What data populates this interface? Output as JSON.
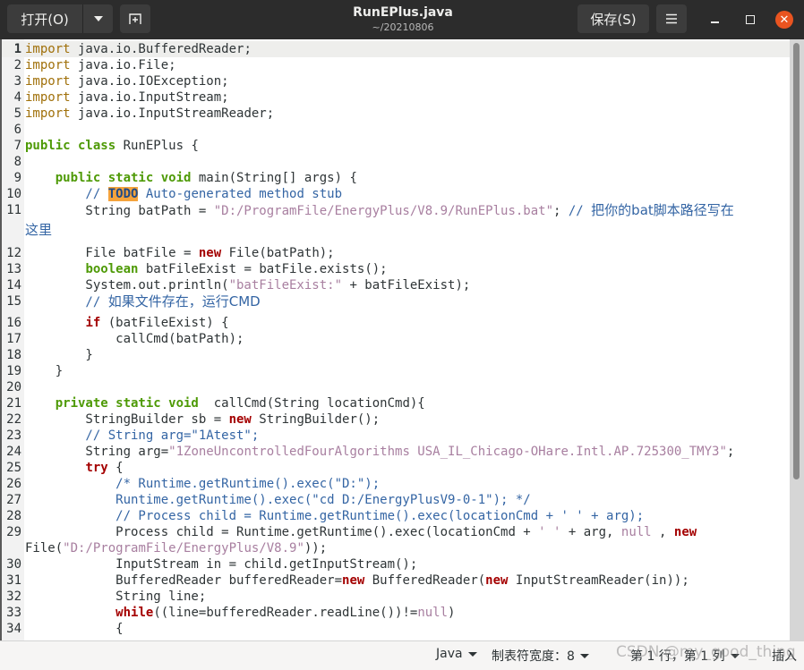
{
  "titlebar": {
    "open_label": "打开(O)",
    "title": "RunEPlus.java",
    "subtitle": "~/20210806",
    "save_label": "保存(S)",
    "close_glyph": "✕",
    "accent_close": "#e95420"
  },
  "editor": {
    "current_line": 1,
    "lines": [
      {
        "n": "1",
        "segments": [
          {
            "c": "kw-imp",
            "t": "import"
          },
          {
            "c": "",
            "t": " java.io.BufferedReader;"
          }
        ]
      },
      {
        "n": "2",
        "segments": [
          {
            "c": "kw-imp",
            "t": "import"
          },
          {
            "c": "",
            "t": " java.io.File;"
          }
        ]
      },
      {
        "n": "3",
        "segments": [
          {
            "c": "kw-imp",
            "t": "import"
          },
          {
            "c": "",
            "t": " java.io.IOException;"
          }
        ]
      },
      {
        "n": "4",
        "segments": [
          {
            "c": "kw-imp",
            "t": "import"
          },
          {
            "c": "",
            "t": " java.io.InputStream;"
          }
        ]
      },
      {
        "n": "5",
        "segments": [
          {
            "c": "kw-imp",
            "t": "import"
          },
          {
            "c": "",
            "t": " java.io.InputStreamReader;"
          }
        ]
      },
      {
        "n": "6",
        "segments": []
      },
      {
        "n": "7",
        "segments": [
          {
            "c": "kw-g",
            "t": "public class"
          },
          {
            "c": "",
            "t": " RunEPlus {"
          }
        ]
      },
      {
        "n": "8",
        "segments": []
      },
      {
        "n": "9",
        "segments": [
          {
            "c": "",
            "t": "    "
          },
          {
            "c": "kw-g",
            "t": "public static void"
          },
          {
            "c": "",
            "t": " main(String[] args) {"
          }
        ]
      },
      {
        "n": "10",
        "segments": [
          {
            "c": "cmt",
            "t": "        // "
          },
          {
            "c": "todo",
            "t": "TODO"
          },
          {
            "c": "cmt",
            "t": " Auto-generated method stub"
          }
        ]
      },
      {
        "n": "11",
        "segments": [
          {
            "c": "",
            "t": "        String batPath = "
          },
          {
            "c": "str",
            "t": "\"D:/ProgramFile/EnergyPlus/V8.9/RunEPlus.bat\""
          },
          {
            "c": "",
            "t": "; "
          },
          {
            "c": "cmt",
            "t": "// "
          },
          {
            "c": "cmt cjk",
            "t": "把你的bat脚本路径写在"
          }
        ],
        "wrap": [
          {
            "c": "cmt cjk",
            "t": "这里"
          }
        ]
      },
      {
        "n": "12",
        "segments": [
          {
            "c": "",
            "t": "        File batFile = "
          },
          {
            "c": "kw-r",
            "t": "new"
          },
          {
            "c": "",
            "t": " File(batPath);"
          }
        ]
      },
      {
        "n": "13",
        "segments": [
          {
            "c": "",
            "t": "        "
          },
          {
            "c": "kw-g",
            "t": "boolean"
          },
          {
            "c": "",
            "t": " batFileExist = batFile.exists();"
          }
        ]
      },
      {
        "n": "14",
        "segments": [
          {
            "c": "",
            "t": "        System.out.println("
          },
          {
            "c": "str",
            "t": "\"batFileExist:\""
          },
          {
            "c": "",
            "t": " + batFileExist);"
          }
        ]
      },
      {
        "n": "15",
        "segments": [
          {
            "c": "cmt",
            "t": "        // "
          },
          {
            "c": "cmt cjk",
            "t": "如果文件存在，运行CMD"
          }
        ]
      },
      {
        "n": "16",
        "segments": [
          {
            "c": "",
            "t": "        "
          },
          {
            "c": "kw-r",
            "t": "if"
          },
          {
            "c": "",
            "t": " (batFileExist) {"
          }
        ]
      },
      {
        "n": "17",
        "segments": [
          {
            "c": "",
            "t": "            callCmd(batPath);"
          }
        ]
      },
      {
        "n": "18",
        "segments": [
          {
            "c": "",
            "t": "        }"
          }
        ]
      },
      {
        "n": "19",
        "segments": [
          {
            "c": "",
            "t": "    }"
          }
        ]
      },
      {
        "n": "20",
        "segments": []
      },
      {
        "n": "21",
        "segments": [
          {
            "c": "",
            "t": "    "
          },
          {
            "c": "kw-g",
            "t": "private static void"
          },
          {
            "c": "",
            "t": "  callCmd(String locationCmd){"
          }
        ]
      },
      {
        "n": "22",
        "segments": [
          {
            "c": "",
            "t": "        StringBuilder sb = "
          },
          {
            "c": "kw-r",
            "t": "new"
          },
          {
            "c": "",
            "t": " StringBuilder();"
          }
        ]
      },
      {
        "n": "23",
        "segments": [
          {
            "c": "cmt",
            "t": "        // String arg=\"1Atest\";"
          }
        ]
      },
      {
        "n": "24",
        "segments": [
          {
            "c": "",
            "t": "        String arg="
          },
          {
            "c": "str",
            "t": "\"1ZoneUncontrolledFourAlgorithms USA_IL_Chicago-OHare.Intl.AP.725300_TMY3\""
          },
          {
            "c": "",
            "t": ";"
          }
        ]
      },
      {
        "n": "25",
        "segments": [
          {
            "c": "",
            "t": "        "
          },
          {
            "c": "kw-r",
            "t": "try"
          },
          {
            "c": "",
            "t": " {"
          }
        ]
      },
      {
        "n": "26",
        "segments": [
          {
            "c": "cmt",
            "t": "            /* Runtime.getRuntime().exec(\"D:\");"
          }
        ]
      },
      {
        "n": "27",
        "segments": [
          {
            "c": "cmt",
            "t": "            Runtime.getRuntime().exec(\"cd D:/EnergyPlusV9-0-1\"); */"
          }
        ]
      },
      {
        "n": "28",
        "segments": [
          {
            "c": "cmt",
            "t": "            // Process child = Runtime.getRuntime().exec(locationCmd + ' ' + arg);"
          }
        ]
      },
      {
        "n": "29",
        "segments": [
          {
            "c": "",
            "t": "            Process child = Runtime.getRuntime().exec(locationCmd + "
          },
          {
            "c": "str",
            "t": "' '"
          },
          {
            "c": "",
            "t": " + arg, "
          },
          {
            "c": "str",
            "t": "null"
          },
          {
            "c": "",
            "t": " , "
          },
          {
            "c": "kw-r",
            "t": "new"
          }
        ],
        "wrap": [
          {
            "c": "",
            "t": "File("
          },
          {
            "c": "str",
            "t": "\"D:/ProgramFile/EnergyPlus/V8.9\""
          },
          {
            "c": "",
            "t": "));"
          }
        ]
      },
      {
        "n": "30",
        "segments": [
          {
            "c": "",
            "t": "            InputStream in = child.getInputStream();"
          }
        ]
      },
      {
        "n": "31",
        "segments": [
          {
            "c": "",
            "t": "            BufferedReader bufferedReader="
          },
          {
            "c": "kw-r",
            "t": "new"
          },
          {
            "c": "",
            "t": " BufferedReader("
          },
          {
            "c": "kw-r",
            "t": "new"
          },
          {
            "c": "",
            "t": " InputStreamReader(in));"
          }
        ]
      },
      {
        "n": "32",
        "segments": [
          {
            "c": "",
            "t": "            String line;"
          }
        ]
      },
      {
        "n": "33",
        "segments": [
          {
            "c": "",
            "t": "            "
          },
          {
            "c": "kw-r",
            "t": "while"
          },
          {
            "c": "",
            "t": "((line=bufferedReader.readLine())!="
          },
          {
            "c": "str",
            "t": "null"
          },
          {
            "c": "",
            "t": ")"
          }
        ]
      },
      {
        "n": "34",
        "segments": [
          {
            "c": "",
            "t": "            {"
          }
        ]
      }
    ]
  },
  "statusbar": {
    "language": "Java",
    "tab_width": "制表符宽度：8",
    "position": "第 1 行，第 1 列",
    "mode": "插入",
    "watermark": "CSDN @my_good_thing"
  }
}
